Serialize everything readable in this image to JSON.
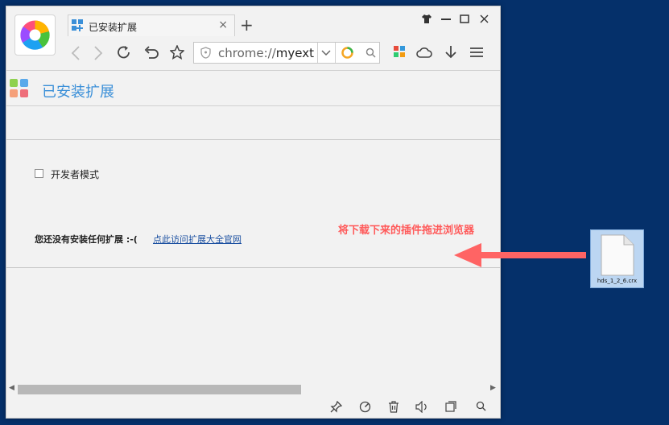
{
  "tab": {
    "title": "已安装扩展",
    "close_glyph": "×"
  },
  "new_tab_glyph": "+",
  "window_controls": {
    "skin": "shirt-icon",
    "minimize": "—",
    "maximize": "□",
    "close": "✕"
  },
  "address": {
    "prefix": "chrome://",
    "path": "myext"
  },
  "page": {
    "title": "已安装扩展",
    "developer_mode_label": "开发者模式",
    "developer_mode_checked": false,
    "empty_message": "您还没有安装任何扩展 :-(",
    "visit_link": "点此访问扩展大全官网"
  },
  "annotation": {
    "hint": "将下载下来的插件拖进浏览器",
    "color": "#ff6464"
  },
  "desktop_file": {
    "name": "hds_1_2_6.crx"
  },
  "colors": {
    "desktop_bg": "#05306a",
    "accent": "#3a8fd8",
    "link": "#1a4fa0"
  }
}
